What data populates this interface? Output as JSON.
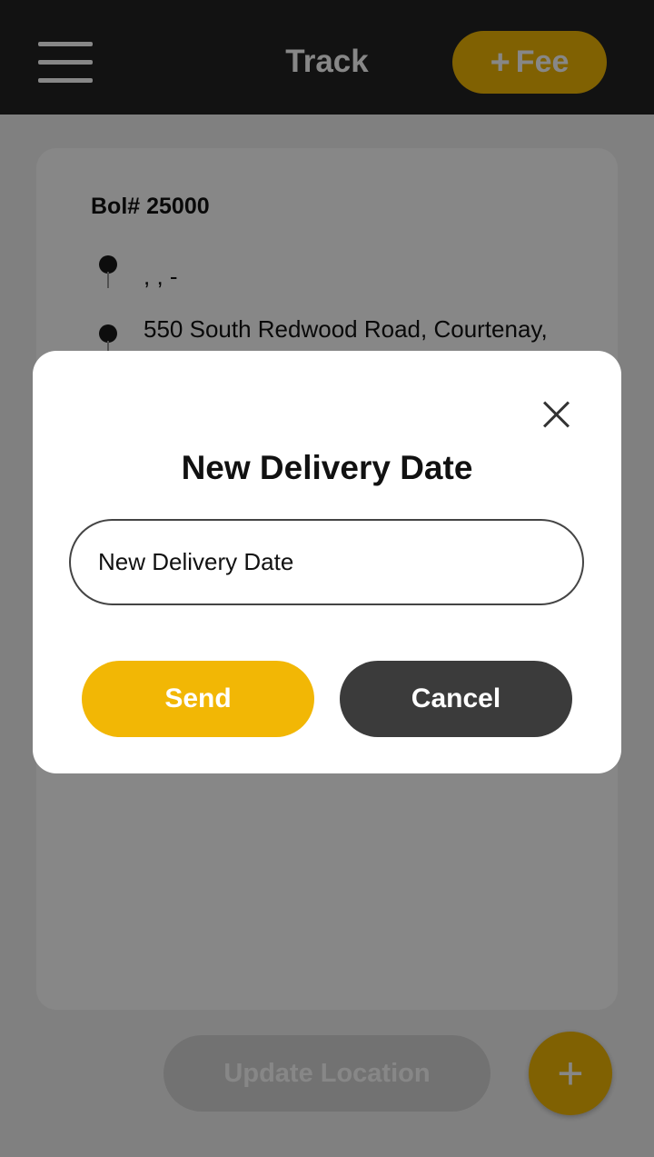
{
  "header": {
    "title": "Track",
    "fee_button_label": "Fee",
    "fee_button_icon": "plus-icon"
  },
  "card": {
    "bol": "Bol# 25000",
    "origin": ", , -",
    "destination": "550 South Redwood Road, Courtenay, BC 84054"
  },
  "bottom": {
    "update_location_label": "Update Location",
    "fab_icon": "plus-icon"
  },
  "modal": {
    "title": "New Delivery Date",
    "input_placeholder": "New Delivery Date",
    "input_value": "",
    "send_label": "Send",
    "cancel_label": "Cancel"
  },
  "colors": {
    "accent": "#f2b705",
    "header_bg": "#232323",
    "dark_button": "#3b3b3b"
  }
}
